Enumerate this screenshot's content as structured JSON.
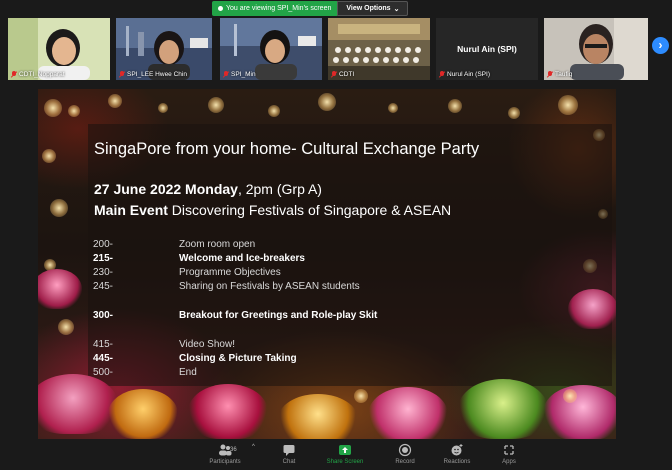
{
  "banner": {
    "viewing_text": "You are viewing SPI_Min's screen",
    "options_label": "View Options",
    "options_caret": "⌄"
  },
  "participants": [
    {
      "name": "CDTI_Nopparat",
      "muted": true
    },
    {
      "name": "SPI_LEE Hwee Chin",
      "muted": true
    },
    {
      "name": "SPI_Min",
      "muted": true
    },
    {
      "name": "CDTI",
      "muted": true
    },
    {
      "name": "Nurul Ain (SPI)",
      "big_name": "Nurul Ain (SPI)",
      "muted": true
    },
    {
      "name": "Taufiq",
      "muted": true
    }
  ],
  "gallery_next": "›",
  "slide": {
    "title": "SingaPore from your home- Cultural Exchange Party",
    "date_bold": "27 June 2022 Monday",
    "date_rest": ", 2pm (Grp A)",
    "main_bold": "Main Event",
    "main_rest": " Discovering Festivals of Singapore & ASEAN",
    "schedule": [
      {
        "time": "200-",
        "item": "Zoom room open",
        "style": "dim"
      },
      {
        "time": "215-",
        "item": "Welcome and Ice-breakers",
        "style": "bold"
      },
      {
        "time": "230-",
        "item": "Programme Objectives",
        "style": "dim"
      },
      {
        "time": "245-",
        "item": "Sharing on Festivals by ASEAN students",
        "style": "dim"
      },
      {
        "time": "300-",
        "item": "Breakout for Greetings and Role-play Skit",
        "style": "bold"
      },
      {
        "time": "415-",
        "item": "Video Show!",
        "style": "dim"
      },
      {
        "time": "445-",
        "item": "Closing & Picture Taking",
        "style": "bold"
      },
      {
        "time": "500-",
        "item": "End",
        "style": "dim"
      }
    ]
  },
  "toolbar": {
    "participants_label": "Participants",
    "participants_count": "36",
    "participants_caret": "^",
    "chat_label": "Chat",
    "share_label": "Share Screen",
    "record_label": "Record",
    "reactions_label": "Reactions",
    "apps_label": "Apps"
  },
  "colors": {
    "share_green": "#22a447",
    "zoom_blue": "#2d8cff",
    "muted_red": "#e02828",
    "toolbar_bg": "#1a1a1a"
  }
}
